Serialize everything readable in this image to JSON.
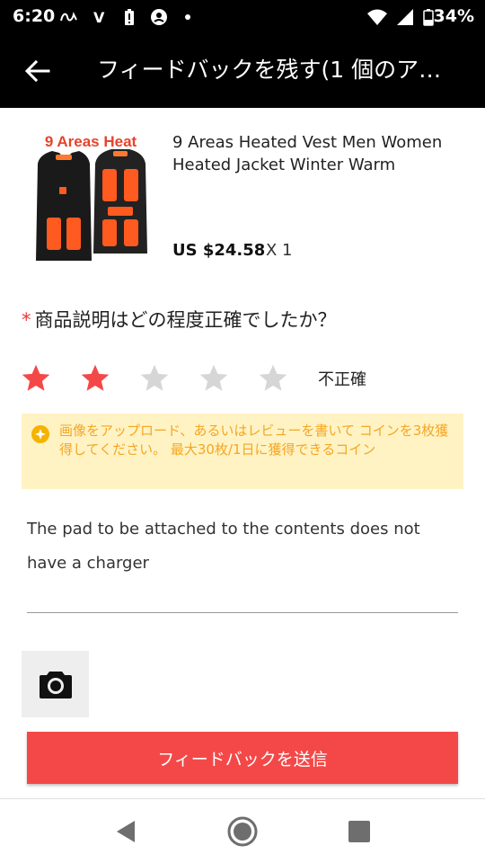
{
  "status_bar": {
    "time": "6:20",
    "notification_v": "V",
    "battery": "34%"
  },
  "app_bar": {
    "title": "フィードバックを残す(1 個のア…"
  },
  "product": {
    "image_caption": "9 Areas Heat",
    "title": "9 Areas Heated Vest Men Women Heated Jacket Winter Warm",
    "price": "US $24.58",
    "quantity": "X 1"
  },
  "question": {
    "required_mark": "*",
    "text": "商品説明はどの程度正確でしたか？"
  },
  "rating": {
    "value": 2,
    "max": 5,
    "label": "不正確",
    "active_color": "#f44848",
    "inactive_color": "#d6d6d6"
  },
  "tip": {
    "text": "画像をアップロード、あるいはレビューを書いて コインを3枚獲得してください。 最大30枚/1日に獲得できるコイン"
  },
  "review": {
    "text": "The pad to be attached to the contents does not have a charger"
  },
  "submit": {
    "label": "フィードバックを送信"
  }
}
